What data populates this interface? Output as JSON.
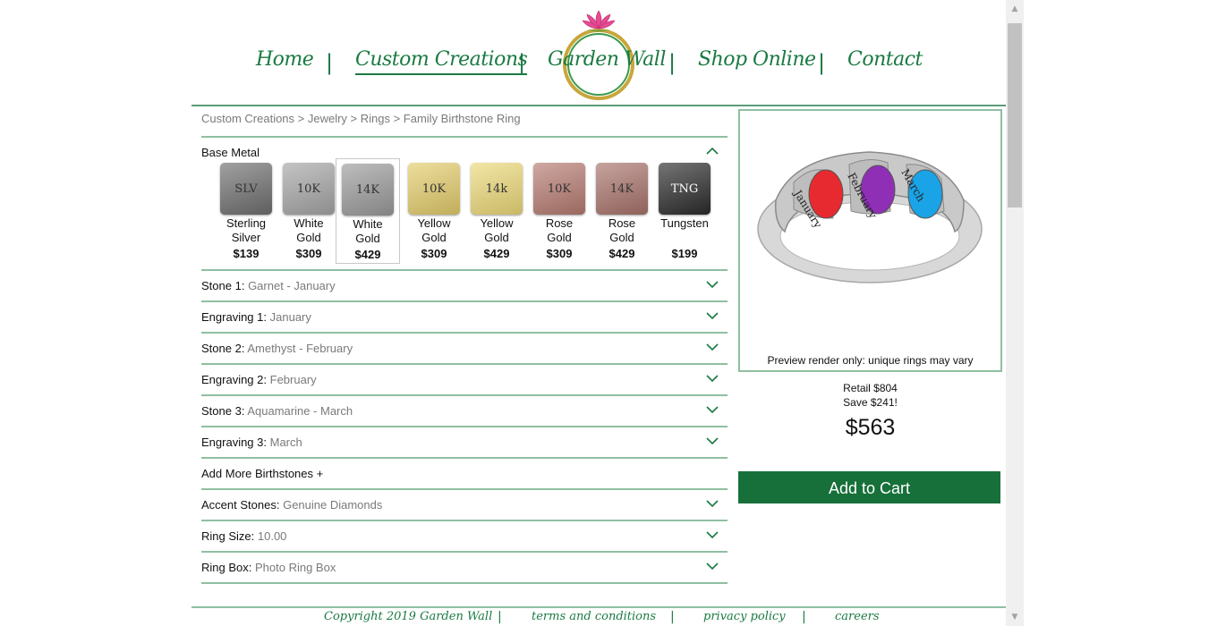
{
  "nav": {
    "items": [
      "Home",
      "Custom Creations",
      "Garden Wall",
      "Shop Online",
      "Contact"
    ],
    "separator": "|"
  },
  "breadcrumb": "Custom Creations > Jewelry > Rings > Family Birthstone Ring",
  "base_metal": {
    "label": "Base Metal",
    "options": [
      {
        "code": "SLV",
        "name1": "Sterling",
        "name2": "Silver",
        "price": "$139",
        "color": "#6e6e6e"
      },
      {
        "code": "10K",
        "name1": "White",
        "name2": "Gold",
        "price": "$309",
        "color": "#a5a5a5"
      },
      {
        "code": "14K",
        "name1": "White",
        "name2": "Gold",
        "price": "$429",
        "color": "#9a9a9a"
      },
      {
        "code": "10K",
        "name1": "Yellow",
        "name2": "Gold",
        "price": "$309",
        "color": "#e3cc6a"
      },
      {
        "code": "14k",
        "name1": "Yellow",
        "name2": "Gold",
        "price": "$429",
        "color": "#ecd978"
      },
      {
        "code": "10K",
        "name1": "Rose",
        "name2": "Gold",
        "price": "$309",
        "color": "#b57a70"
      },
      {
        "code": "14K",
        "name1": "Rose",
        "name2": "Gold",
        "price": "$429",
        "color": "#a8726a"
      },
      {
        "code": "TNG",
        "name1": "Tungsten",
        "name2": "",
        "price": "$199",
        "color": "#2b2b2b"
      }
    ]
  },
  "options": [
    {
      "label": "Stone 1:",
      "value": "Garnet - January"
    },
    {
      "label": "Engraving 1:",
      "value": "January"
    },
    {
      "label": "Stone 2:",
      "value": "Amethyst - February"
    },
    {
      "label": "Engraving 2:",
      "value": "February"
    },
    {
      "label": "Stone 3:",
      "value": "Aquamarine - March"
    },
    {
      "label": "Engraving 3:",
      "value": "March"
    },
    {
      "label": "Add More Birthstones +",
      "value": ""
    },
    {
      "label": "Accent Stones:",
      "value": "Genuine Diamonds"
    },
    {
      "label": "Ring Size:",
      "value": "10.00"
    },
    {
      "label": "Ring Box:",
      "value": "Photo Ring Box"
    }
  ],
  "preview": {
    "caption": "Preview render only: unique rings may vary",
    "engravings": [
      "January",
      "February",
      "March"
    ],
    "stone_colors": [
      "#e62a2f",
      "#8e2fb6",
      "#1aa3e6"
    ]
  },
  "pricing": {
    "retail": "Retail $804",
    "save": "Save $241!",
    "price": "$563"
  },
  "cart_label": "Add to Cart",
  "footer": {
    "links": [
      "Copyright 2019 Garden Wall",
      "terms and conditions",
      "privacy policy",
      "careers"
    ],
    "separator": "|"
  },
  "colors": {
    "brand_green": "#1a7a42",
    "line_green": "#8fbfa2",
    "button_green": "#17703a"
  }
}
